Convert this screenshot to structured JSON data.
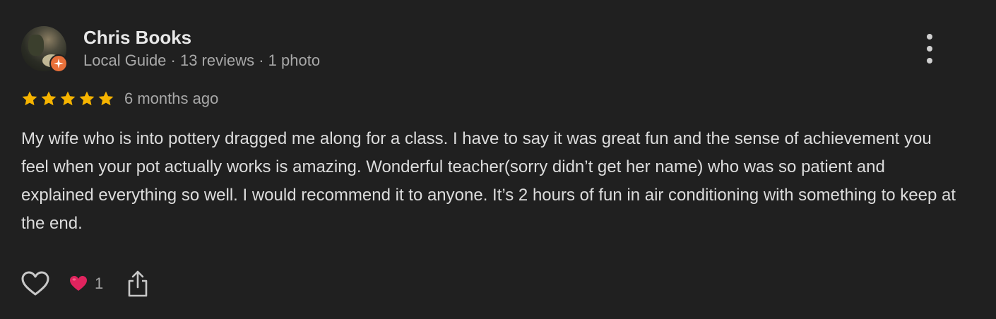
{
  "reviewer": {
    "name": "Chris Books",
    "meta": "Local Guide · 13 reviews · 1 photo",
    "badge": "local-guide-badge"
  },
  "rating": {
    "stars": 5,
    "max_stars": 5,
    "date": "6 months ago",
    "star_color": "#f6b400"
  },
  "review": {
    "text": "My wife who is into pottery dragged me along for a class. I have to say it was great fun and the sense of achievement you feel when your pot actually works is amazing. Wonderful teacher(sorry didn’t get her name) who was so patient and explained everything so well. I would recommend it to anyone. It’s 2 hours of fun in air conditioning with something to keep at the end."
  },
  "actions": {
    "like_icon": "heart-outline-icon",
    "reaction_icon": "red-heart-emoji",
    "reaction_count": "1",
    "share_icon": "share-icon",
    "more_icon": "more-vertical-icon"
  },
  "colors": {
    "background": "#202020",
    "text": "#dcdcdc",
    "muted": "#a8a8a8",
    "badge": "#e8703a",
    "heart": "#e0245e"
  }
}
